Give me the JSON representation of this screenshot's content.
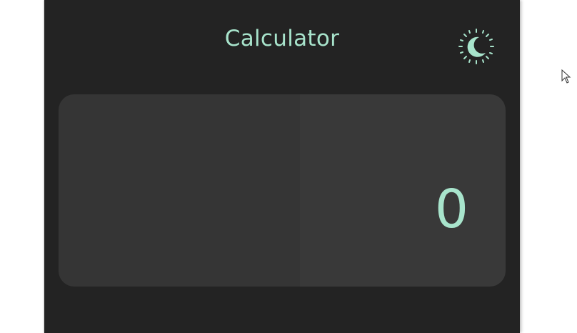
{
  "app": {
    "title": "Calculator"
  },
  "theme_toggle": {
    "icon": "moon-sun-icon",
    "mode": "dark"
  },
  "display": {
    "value": "0"
  },
  "colors": {
    "accent": "#a8e4cc",
    "panel_bg": "#232323",
    "display_bg": "#353535",
    "page_bg": "#ffffff"
  }
}
